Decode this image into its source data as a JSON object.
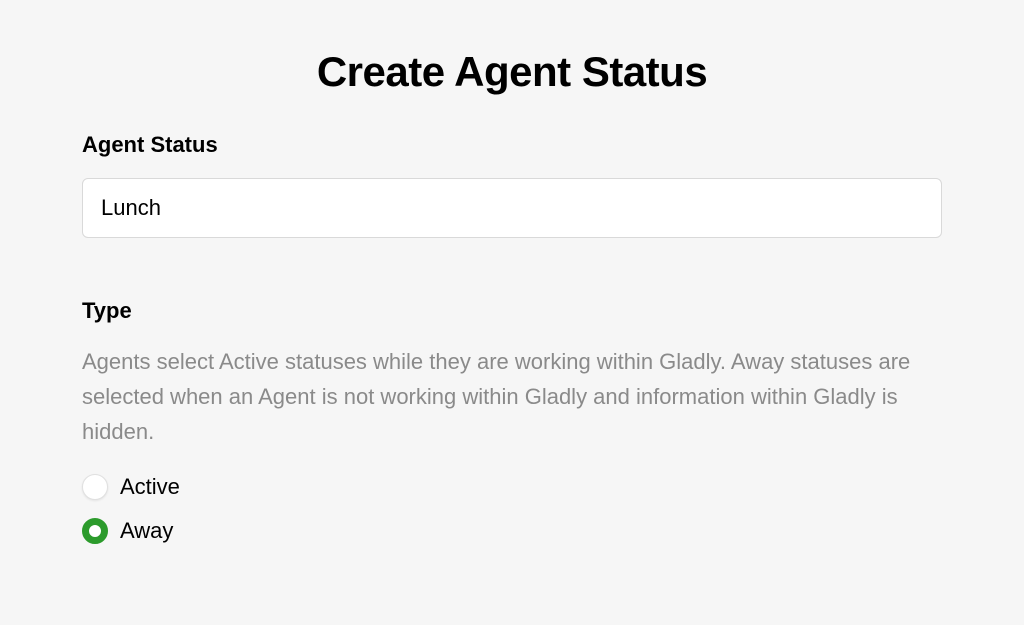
{
  "title": "Create Agent Status",
  "agentStatus": {
    "label": "Agent Status",
    "value": "Lunch"
  },
  "type": {
    "label": "Type",
    "description": "Agents select Active statuses while they are working within Gladly. Away statuses are selected when an Agent is not working within Gladly and information within Gladly is hidden.",
    "options": [
      {
        "label": "Active",
        "selected": false
      },
      {
        "label": "Away",
        "selected": true
      }
    ]
  }
}
